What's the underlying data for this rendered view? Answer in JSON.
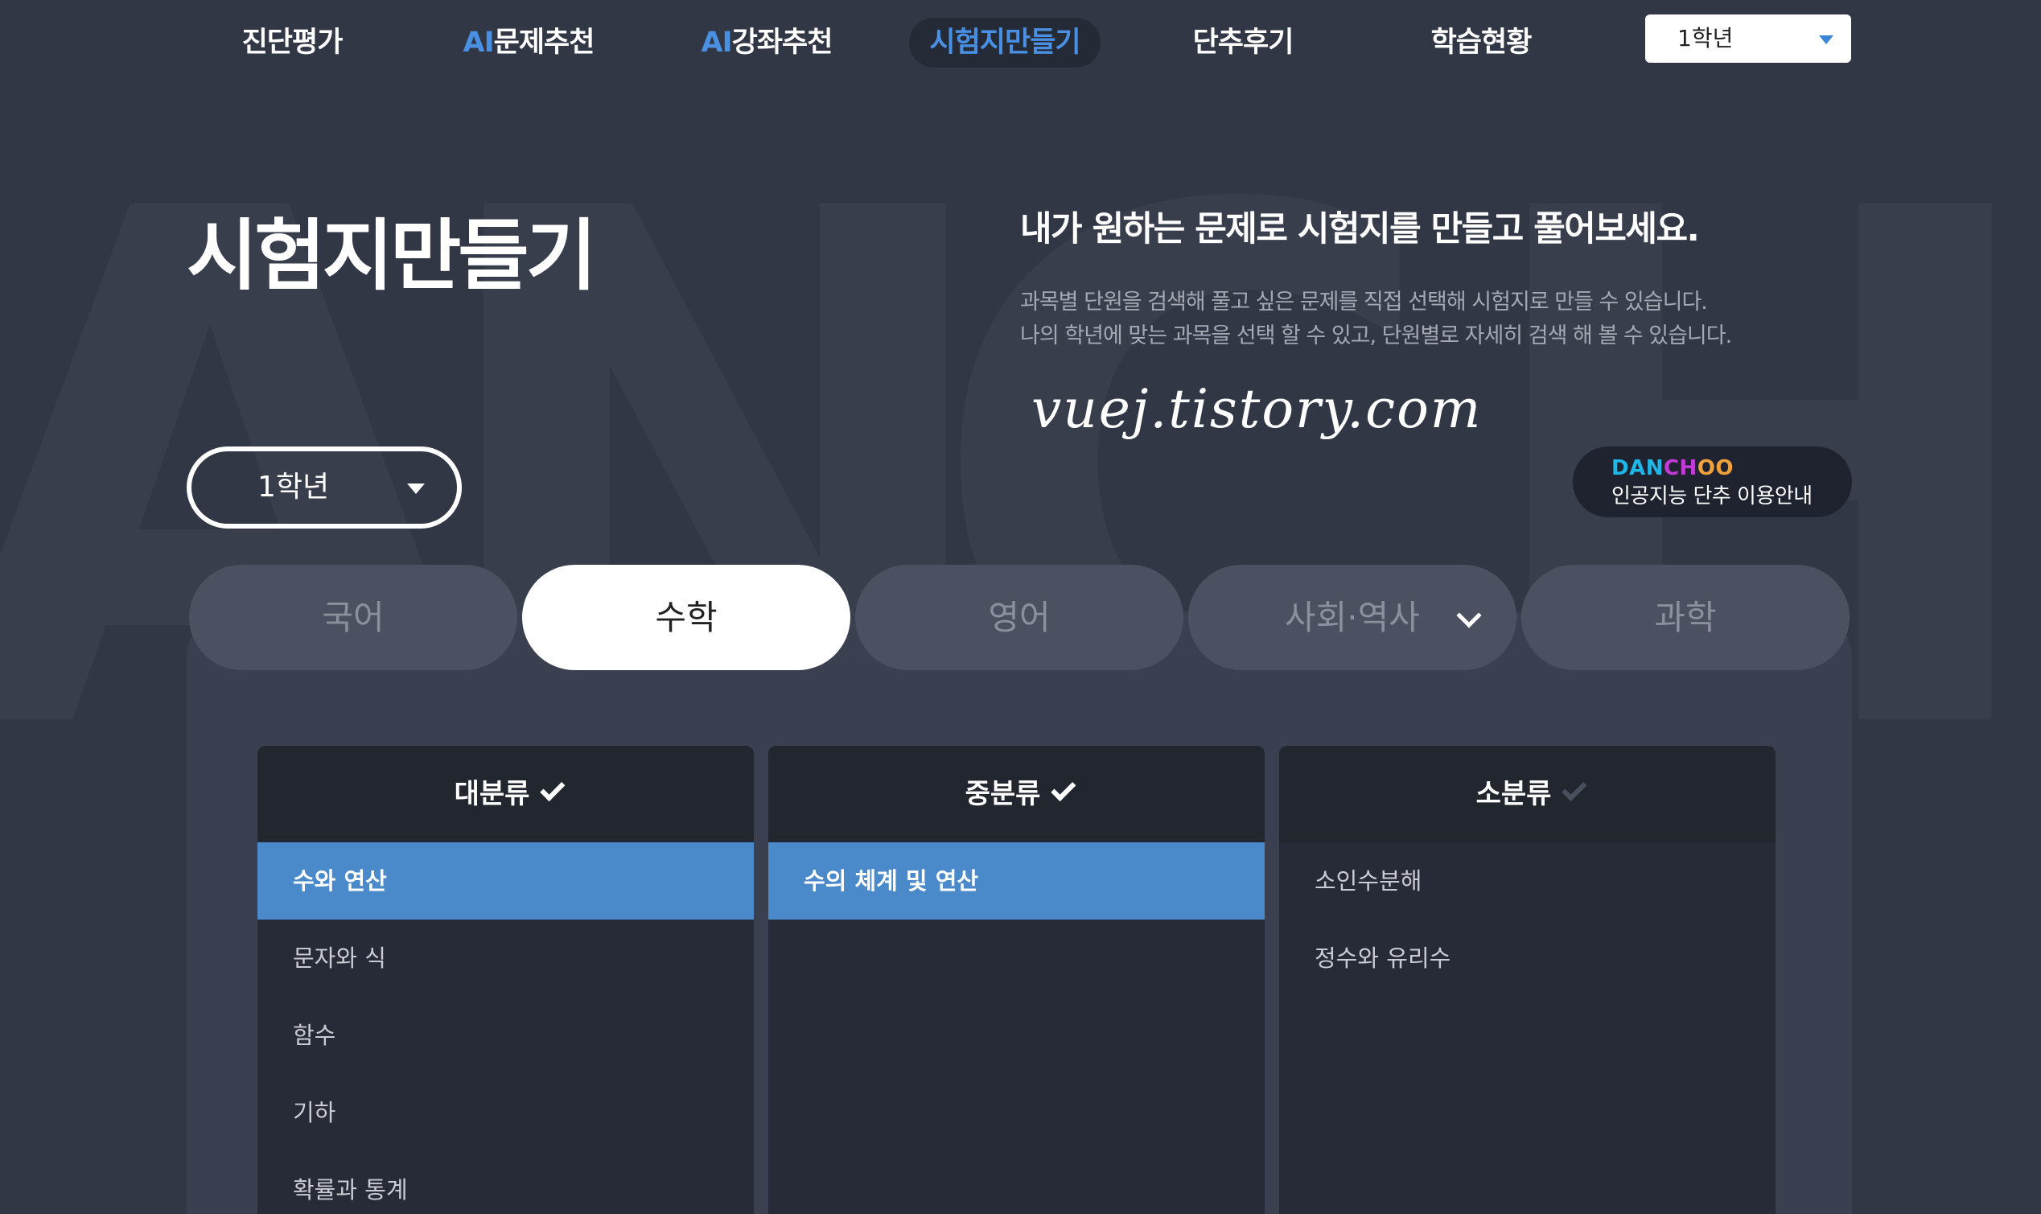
{
  "nav": {
    "items": [
      {
        "prefix": "",
        "label": "진단평가"
      },
      {
        "prefix": "AI",
        "label": "문제추천"
      },
      {
        "prefix": "AI",
        "label": "강좌추천"
      },
      {
        "prefix": "",
        "label": "시험지만들기"
      },
      {
        "prefix": "",
        "label": "단추후기"
      },
      {
        "prefix": "",
        "label": "학습현황"
      }
    ],
    "active": "시험지만들기",
    "grade_select": "1학년"
  },
  "header": {
    "title": "시험지만들기",
    "headline": "내가 원하는 문제로 시험지를 만들고 풀어보세요.",
    "desc_line1": "과목별 단원을 검색해 풀고 싶은 문제를 직접 선택해 시험지로 만들 수 있습니다.",
    "desc_line2": "나의 학년에 맞는 과목을 선택 할 수 있고, 단원별로 자세히 검색 해 볼 수 있습니다.",
    "watermark": "vuej.tistory.com",
    "grade_select": "1학년"
  },
  "danchoo": {
    "logo_part1": "DAN",
    "logo_part2": "CH",
    "logo_part3": "OO",
    "subtitle": "인공지능 단추 이용안내"
  },
  "subjects": {
    "tabs": [
      "국어",
      "수학",
      "영어",
      "사회·역사",
      "과학"
    ],
    "active": "수학"
  },
  "categories": {
    "major": {
      "header": "대분류",
      "items": [
        "수와 연산",
        "문자와 식",
        "함수",
        "기하",
        "확률과 통계"
      ],
      "selected": "수와 연산"
    },
    "middle": {
      "header": "중분류",
      "items": [
        "수의 체계 및 연산"
      ],
      "selected": "수의 체계 및 연산"
    },
    "minor": {
      "header": "소분류",
      "items": [
        "소인수분해",
        "정수와 유리수"
      ]
    }
  },
  "colors": {
    "background": "#323746",
    "accent": "#4a90e2",
    "selected_row": "#4a8acb"
  }
}
